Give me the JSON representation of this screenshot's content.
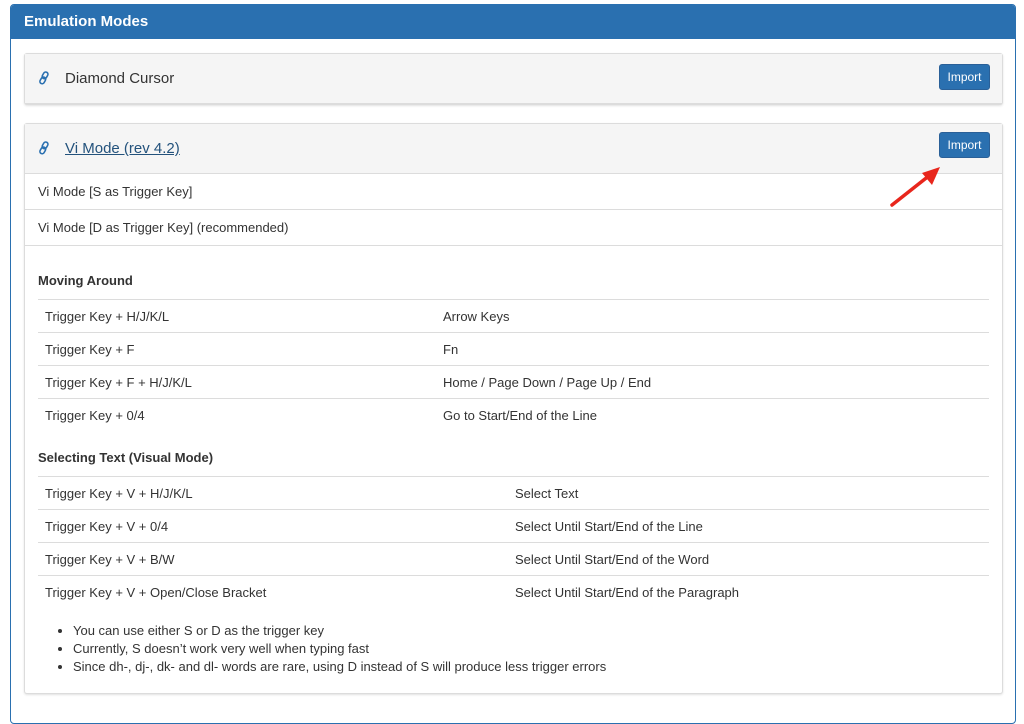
{
  "panel": {
    "title": "Emulation Modes"
  },
  "cards": {
    "diamond": {
      "title": "Diamond Cursor",
      "import_label": "Import"
    },
    "vi": {
      "title": "Vi Mode (rev 4.2)",
      "import_label": "Import",
      "variants": [
        "Vi Mode [S as Trigger Key]",
        "Vi Mode [D as Trigger Key] (recommended)"
      ],
      "sections": [
        {
          "heading": "Moving Around",
          "rows": [
            [
              "Trigger Key + H/J/K/L",
              "Arrow Keys"
            ],
            [
              "Trigger Key + F",
              "Fn"
            ],
            [
              "Trigger Key + F + H/J/K/L",
              "Home / Page Down / Page Up / End"
            ],
            [
              "Trigger Key + 0/4",
              "Go to Start/End of the Line"
            ]
          ]
        },
        {
          "heading": "Selecting Text (Visual Mode)",
          "rows": [
            [
              "Trigger Key + V + H/J/K/L",
              "Select Text"
            ],
            [
              "Trigger Key + V + 0/4",
              "Select Until Start/End of the Line"
            ],
            [
              "Trigger Key + V + B/W",
              "Select Until Start/End of the Word"
            ],
            [
              "Trigger Key + V + Open/Close Bracket",
              "Select Until Start/End of the Paragraph"
            ]
          ]
        }
      ],
      "notes": [
        "You can use either S or D as the trigger key",
        "Currently, S doesn’t work very well when typing fast",
        "Since dh-, dj-, dk- and dl- words are rare, using D instead of S will produce less trigger errors"
      ]
    }
  },
  "colors": {
    "accent": "#2a70b0",
    "link": "#23527c",
    "annotation_arrow": "#e8261c"
  }
}
